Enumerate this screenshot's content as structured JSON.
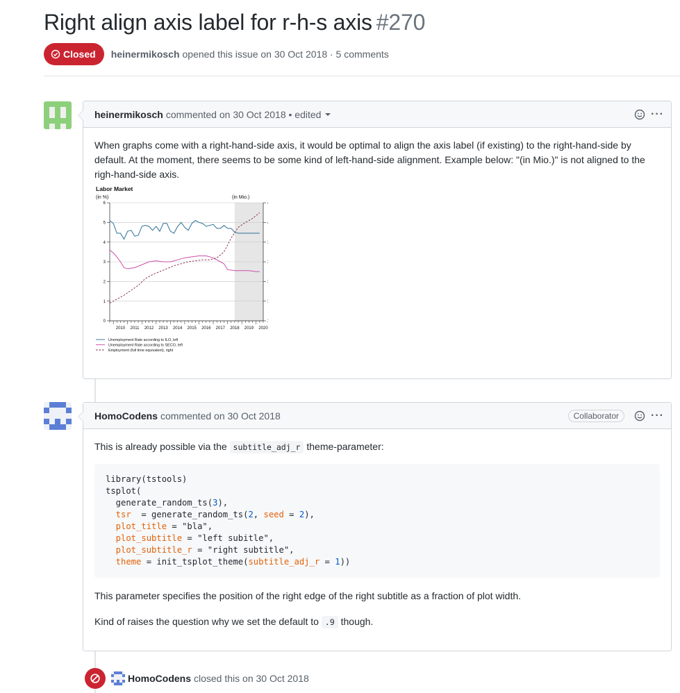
{
  "issue": {
    "title": "Right align axis label for r-h-s axis",
    "number": "#270",
    "state": "Closed",
    "author": "heinermikosch",
    "opened_text": "opened this issue on 30 Oct 2018 · 5 comments"
  },
  "comments": [
    {
      "author": "heinermikosch",
      "meta": "commented on 30 Oct 2018 • edited",
      "body_text": "When graphs come with a right-hand-side axis, it would be optimal to align the axis label (if existing) to the right-hand-side by default. At the moment, there seems to be some kind of left-hand-side alignment. Example below: \"(in Mio.)\" is not aligned to the righ-hand-side axis."
    },
    {
      "author": "HomoCodens",
      "meta": "commented on 30 Oct 2018",
      "badge": "Collaborator",
      "intro_before": "This is already possible via the",
      "intro_code": "subtitle_adj_r",
      "intro_after": "theme-parameter:",
      "code_lines": {
        "l1": "library(tstools)",
        "l2": "tsplot(",
        "l3a": "  generate_random_ts(",
        "l3n": "3",
        "l3b": "),",
        "l4arg": "  tsr",
        "l4a": "  = generate_random_ts(",
        "l4n1": "2",
        "l4s": ", ",
        "l4arg2": "seed",
        "l4e": " = ",
        "l4n2": "2",
        "l4b": "),",
        "l5arg": "  plot_title",
        "l5b": " = \"bla\",",
        "l6arg": "  plot_subtitle",
        "l6b": " = \"left subitle\",",
        "l7arg": "  plot_subtitle_r",
        "l7b": " = \"right subtitle\",",
        "l8arg": "  theme",
        "l8a": " = init_tsplot_theme(",
        "l8arg2": "subtitle_adj_r",
        "l8e": " = ",
        "l8n": "1",
        "l8b": "))"
      },
      "paragraph2": "This parameter specifies the position of the right edge of the right subtitle as a fraction of plot width.",
      "p3_before": "Kind of raises the question why we set the default to",
      "p3_code": ".9",
      "p3_after": "though."
    }
  ],
  "event": {
    "author": "HomoCodens",
    "text": "closed this on 30 Oct 2018"
  },
  "colors": {
    "closed_red": "#cb2431",
    "series_ilo": "#2b6f96",
    "series_seco": "#c94fa9",
    "series_employment": "#7a1f45",
    "shade": "#e6e6e6"
  },
  "chart_data": {
    "type": "line",
    "title": "Labor Market",
    "subtitle_left": "(in %)",
    "subtitle_right": "(in Mio.)",
    "x_ticks": [
      "2010",
      "2011",
      "2012",
      "2013",
      "2014",
      "2015",
      "2016",
      "2017",
      "2018",
      "2019",
      "2020"
    ],
    "xlim": [
      2009.75,
      2020.5
    ],
    "ylim_left": [
      0,
      6
    ],
    "y_ticks_left": [
      "0",
      "1",
      "2",
      "3",
      "4",
      "5",
      "6"
    ],
    "ylim_right": [
      3.5,
      4.1
    ],
    "y_ticks_right": [
      "3.5",
      "3.6",
      "3.7",
      "3.8",
      "3.9",
      "4.0",
      "4.1"
    ],
    "shaded_x_range": [
      2018.5,
      2020.5
    ],
    "grid": true,
    "legend_position": "bottom",
    "series": [
      {
        "name": "Unemployment Rate according to ILO, left",
        "axis": "left",
        "style": "solid",
        "x": [
          2009.75,
          2010.0,
          2010.25,
          2010.5,
          2010.75,
          2011.0,
          2011.25,
          2011.5,
          2011.75,
          2012.0,
          2012.25,
          2012.5,
          2012.75,
          2013.0,
          2013.25,
          2013.5,
          2013.75,
          2014.0,
          2014.25,
          2014.5,
          2014.75,
          2015.0,
          2015.25,
          2015.5,
          2015.75,
          2016.0,
          2016.25,
          2016.5,
          2016.75,
          2017.0,
          2017.25,
          2017.5,
          2017.75,
          2018.0,
          2018.25,
          2018.5,
          2018.75,
          2019.0,
          2019.25,
          2019.5,
          2019.75,
          2020.0,
          2020.25
        ],
        "values": [
          5.1,
          4.95,
          4.45,
          4.45,
          4.15,
          4.55,
          4.6,
          4.3,
          4.35,
          4.8,
          4.85,
          4.8,
          4.6,
          4.8,
          4.55,
          4.95,
          4.95,
          4.55,
          4.45,
          4.8,
          5.0,
          4.75,
          4.6,
          4.95,
          5.1,
          5.0,
          4.95,
          4.8,
          4.85,
          4.9,
          4.7,
          4.7,
          4.85,
          4.7,
          4.7,
          4.5,
          4.45,
          4.45,
          4.45,
          4.45,
          4.45,
          4.45,
          4.45
        ]
      },
      {
        "name": "Unemployment Rate according to SECO, left",
        "axis": "left",
        "style": "solid",
        "x": [
          2009.75,
          2010.0,
          2010.25,
          2010.5,
          2010.75,
          2011.0,
          2011.5,
          2012.0,
          2012.5,
          2013.0,
          2013.5,
          2014.0,
          2014.5,
          2015.0,
          2015.5,
          2016.0,
          2016.5,
          2017.0,
          2017.5,
          2017.75,
          2018.0,
          2018.5,
          2019.0,
          2019.5,
          2020.0,
          2020.25
        ],
        "values": [
          3.6,
          3.45,
          3.25,
          3.0,
          2.7,
          2.65,
          2.7,
          2.85,
          3.0,
          3.05,
          3.0,
          3.0,
          3.1,
          3.2,
          3.25,
          3.3,
          3.3,
          3.2,
          3.0,
          2.9,
          2.6,
          2.55,
          2.55,
          2.55,
          2.5,
          2.5
        ]
      },
      {
        "name": "Employment (full time equivalent), right",
        "axis": "right",
        "style": "dashed",
        "x": [
          2009.75,
          2010.25,
          2010.75,
          2011.25,
          2011.75,
          2012.25,
          2012.75,
          2013.25,
          2013.75,
          2014.25,
          2014.75,
          2015.25,
          2015.75,
          2016.25,
          2016.75,
          2017.25,
          2017.75,
          2018.25,
          2018.75,
          2019.25,
          2019.75,
          2020.25
        ],
        "values": [
          3.59,
          3.61,
          3.63,
          3.655,
          3.68,
          3.715,
          3.735,
          3.75,
          3.765,
          3.78,
          3.79,
          3.8,
          3.805,
          3.81,
          3.81,
          3.82,
          3.85,
          3.92,
          3.975,
          4.0,
          4.02,
          4.05
        ]
      }
    ]
  }
}
